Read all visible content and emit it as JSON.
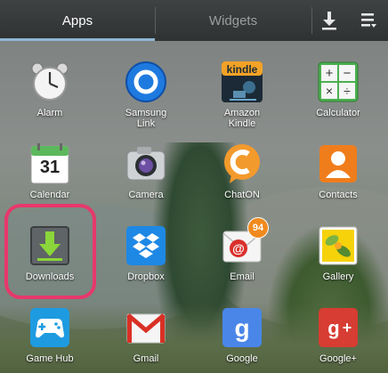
{
  "tabs": [
    {
      "label": "Apps",
      "selected": true
    },
    {
      "label": "Widgets",
      "selected": false
    }
  ],
  "toolbar": {
    "download_icon": "download-icon",
    "menu_icon": "overflow-menu-icon"
  },
  "apps": [
    {
      "label": "Alarm",
      "icon": "alarm-clock-icon"
    },
    {
      "label": "Samsung\nLink",
      "icon": "samsung-link-icon"
    },
    {
      "label": "Amazon\nKindle",
      "icon": "kindle-icon"
    },
    {
      "label": "Calculator",
      "icon": "calculator-icon"
    },
    {
      "label": "Calendar",
      "icon": "calendar-icon",
      "day": "31"
    },
    {
      "label": "Camera",
      "icon": "camera-icon"
    },
    {
      "label": "ChatON",
      "icon": "chaton-icon"
    },
    {
      "label": "Contacts",
      "icon": "contacts-icon"
    },
    {
      "label": "Downloads",
      "icon": "downloads-icon"
    },
    {
      "label": "Dropbox",
      "icon": "dropbox-icon"
    },
    {
      "label": "Email",
      "icon": "email-icon",
      "badge": "94"
    },
    {
      "label": "Gallery",
      "icon": "gallery-icon"
    },
    {
      "label": "Game Hub",
      "icon": "gamepad-icon"
    },
    {
      "label": "Gmail",
      "icon": "gmail-icon"
    },
    {
      "label": "Google",
      "icon": "google-icon"
    },
    {
      "label": "Google+",
      "icon": "google-plus-icon"
    }
  ],
  "colors": {
    "highlight": "#e8386b",
    "tab_underline": "#8fb7d6"
  }
}
